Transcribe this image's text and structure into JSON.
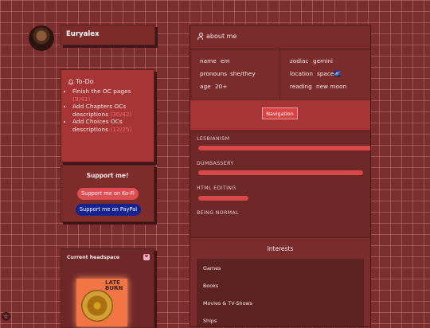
{
  "profile": {
    "username": "Euryalex"
  },
  "todo": {
    "title": "To-Do",
    "items": [
      {
        "text": "Finish the OC pages",
        "count": "(9/41)"
      },
      {
        "text": "Add Chapters OCs descriptions",
        "count": "(30/42)"
      },
      {
        "text": "Add Choices OCs descriptions",
        "count": "(12/25)"
      }
    ]
  },
  "support": {
    "title": "Support me!",
    "kofi_label": "Support me on Ko-Fi",
    "paypal_label": "Support me on PayPal"
  },
  "headspace": {
    "title": "Current headspace",
    "album_text": "LATE BURN"
  },
  "about": {
    "title": "about me",
    "left": [
      {
        "key": "name",
        "value": "em"
      },
      {
        "key": "pronouns",
        "value": "she/they"
      },
      {
        "key": "age",
        "value": "20+"
      }
    ],
    "right": [
      {
        "key": "zodiac",
        "value": "gemini"
      },
      {
        "key": "location",
        "value": "space🌌"
      },
      {
        "key": "reading",
        "value": "new moon"
      }
    ]
  },
  "navigation_label": "Navigation",
  "skills": [
    {
      "label": "LESBIANISM",
      "level": 1.0
    },
    {
      "label": "DUMBASSERY",
      "level": 0.95
    },
    {
      "label": "HTML EDITING",
      "level": 0.29
    },
    {
      "label": "BEING NORMAL",
      "level": 0.0
    }
  ],
  "interests": {
    "title": "Interests",
    "items": [
      "Games",
      "Books",
      "Movies & TV-Shows",
      "Ships"
    ]
  },
  "colors": {
    "background": "#7a2e2e",
    "accent": "#d84848",
    "paypal": "#14228f",
    "kofi": "#dd4d52"
  }
}
